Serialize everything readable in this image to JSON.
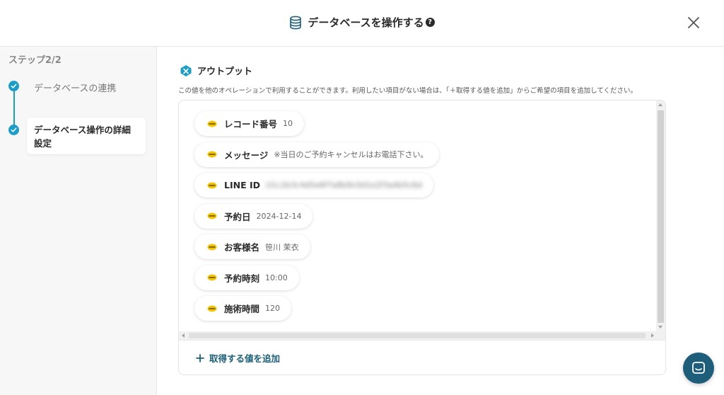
{
  "header": {
    "title": "データベースを操作する",
    "help_glyph": "?",
    "database_icon": "database-icon",
    "close_icon": "close-icon"
  },
  "sidebar": {
    "step_label": "ステップ2/2",
    "steps": [
      {
        "label": "データベースの連携",
        "status": "done"
      },
      {
        "label": "データベース操作の詳細設定",
        "status": "done",
        "active": true
      }
    ]
  },
  "output": {
    "title": "アウトプット",
    "description": "この値を他のオペレーションで利用することができます。利用したい項目がない場合は、「＋取得する値を追加」からご希望の項目を追加してください。",
    "items": [
      {
        "label": "レコード番号",
        "value": "10"
      },
      {
        "label": "メッセージ",
        "value": "※当日のご予約キャンセルはお電話下さい。"
      },
      {
        "label": "LINE ID",
        "value": "U1c2b3c4d5e6f7a8b9c0d1e2f3a4b5c6d",
        "blurred": true
      },
      {
        "label": "予約日",
        "value": "2024-12-14"
      },
      {
        "label": "お客様名",
        "value": "笹川 茉衣"
      },
      {
        "label": "予約時刻",
        "value": "10:00"
      },
      {
        "label": "施術時間",
        "value": "120"
      }
    ],
    "add_button_label": "取得する値を追加"
  },
  "colors": {
    "accent": "#1a9ec9",
    "primary_dark": "#1f5e7a",
    "pill_icon": "#f5c400"
  },
  "chat_icon": "chat-icon"
}
